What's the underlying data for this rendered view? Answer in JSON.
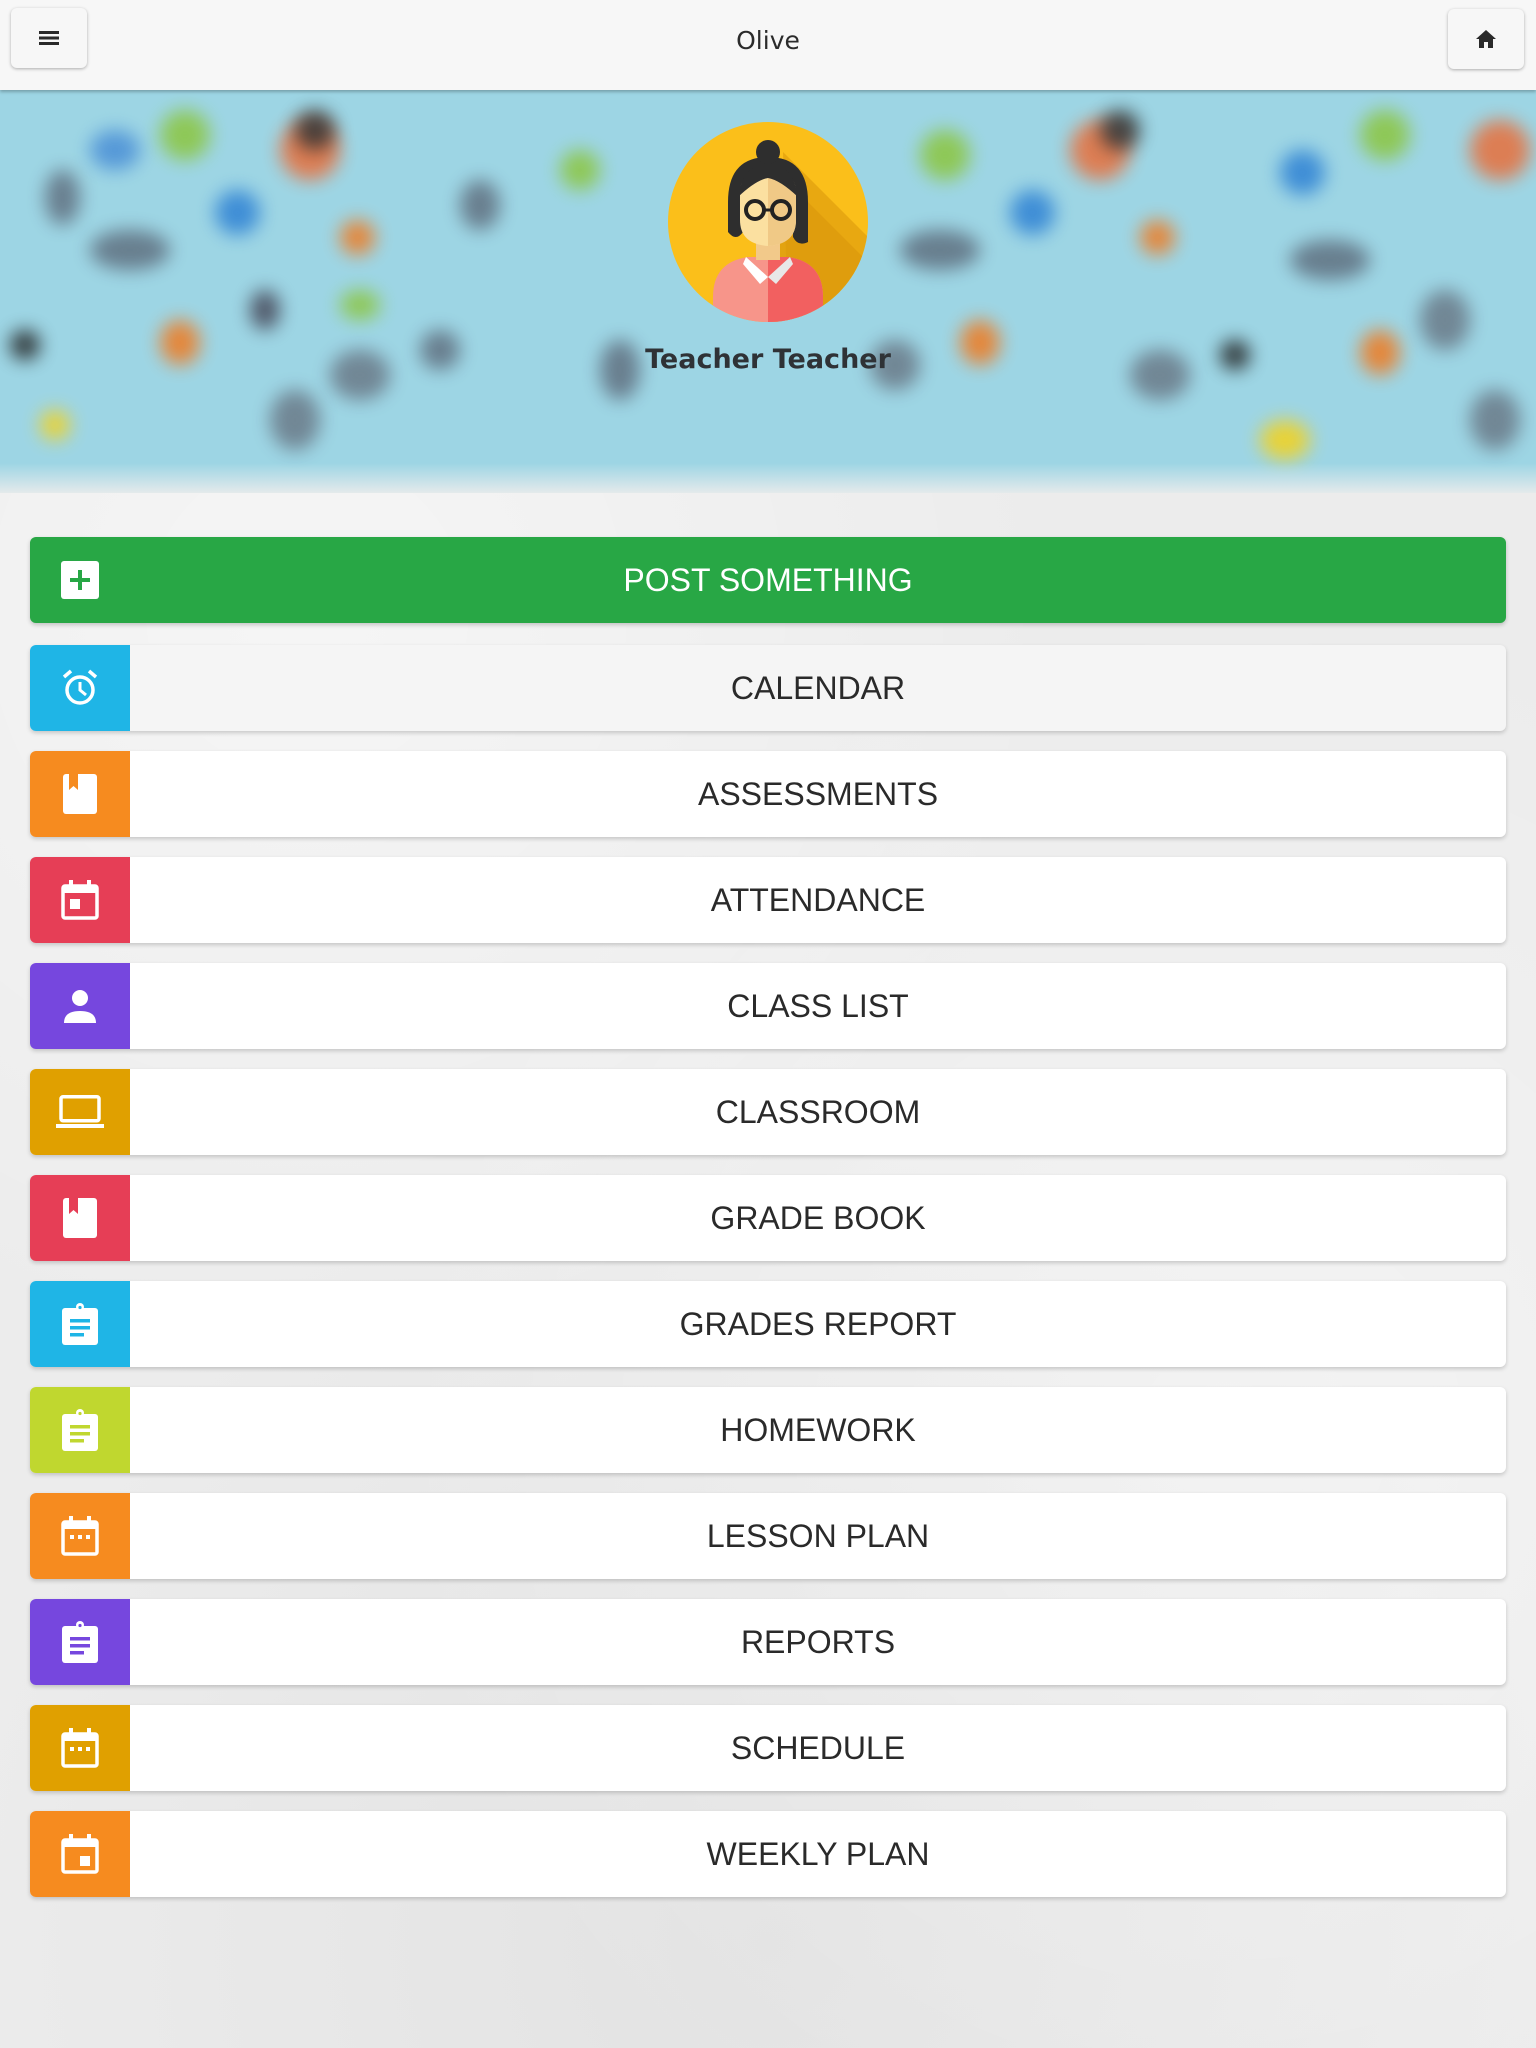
{
  "header": {
    "title": "Olive",
    "menu_icon": "hamburger-menu-icon",
    "home_icon": "home-icon"
  },
  "profile": {
    "name": "Teacher Teacher",
    "avatar": "teacher-avatar-icon"
  },
  "post_button": {
    "label": "POST SOMETHING",
    "icon": "plus-box-icon",
    "color": "#28a745"
  },
  "menu": [
    {
      "label": "CALENDAR",
      "icon": "alarm-clock-icon",
      "color": "#1fb5e6",
      "active": true
    },
    {
      "label": "ASSESSMENTS",
      "icon": "book-icon",
      "color": "#f68b1f",
      "active": false
    },
    {
      "label": "ATTENDANCE",
      "icon": "calendar-event-icon",
      "color": "#e63e56",
      "active": false
    },
    {
      "label": "CLASS LIST",
      "icon": "person-icon",
      "color": "#7647de",
      "active": false
    },
    {
      "label": "CLASSROOM",
      "icon": "laptop-icon",
      "color": "#e0a000",
      "active": false
    },
    {
      "label": "GRADE BOOK",
      "icon": "book-icon",
      "color": "#e63e56",
      "active": false
    },
    {
      "label": "GRADES REPORT",
      "icon": "clipboard-icon",
      "color": "#1fb5e6",
      "active": false
    },
    {
      "label": "HOMEWORK",
      "icon": "clipboard-icon",
      "color": "#c0d72f",
      "active": false
    },
    {
      "label": "LESSON PLAN",
      "icon": "calendar-dots-icon",
      "color": "#f68b1f",
      "active": false
    },
    {
      "label": "REPORTS",
      "icon": "clipboard-icon",
      "color": "#7647de",
      "active": false
    },
    {
      "label": "SCHEDULE",
      "icon": "calendar-dots-icon",
      "color": "#e0a000",
      "active": false
    },
    {
      "label": "WEEKLY PLAN",
      "icon": "calendar-today-icon",
      "color": "#f68b1f",
      "active": false
    }
  ]
}
